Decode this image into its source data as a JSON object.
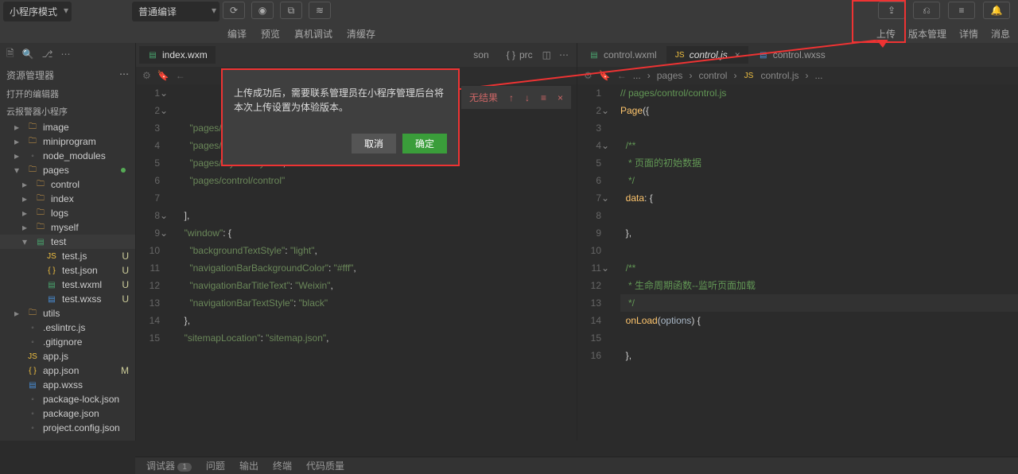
{
  "topbar": {
    "mode": "小程序模式",
    "compile": "普通编译",
    "actions": [
      "编译",
      "预览",
      "真机调试",
      "清缓存"
    ],
    "right": [
      "上传",
      "版本管理",
      "详情",
      "消息"
    ]
  },
  "sidebar": {
    "title": "资源管理器",
    "open_editors": "打开的编辑器",
    "project": "云报警器小程序",
    "tree": [
      {
        "n": "image",
        "t": "folder",
        "d": 0,
        "c": "▸"
      },
      {
        "n": "miniprogram",
        "t": "folder",
        "d": 0,
        "c": "▸"
      },
      {
        "n": "node_modules",
        "t": "folder",
        "d": 0,
        "c": "▸",
        "ico": "grey"
      },
      {
        "n": "pages",
        "t": "folder",
        "d": 0,
        "c": "▾",
        "dot": true
      },
      {
        "n": "control",
        "t": "folder",
        "d": 1,
        "c": "▸"
      },
      {
        "n": "index",
        "t": "folder",
        "d": 1,
        "c": "▸"
      },
      {
        "n": "logs",
        "t": "folder",
        "d": 1,
        "c": "▸"
      },
      {
        "n": "myself",
        "t": "folder",
        "d": 1,
        "c": "▸"
      },
      {
        "n": "test",
        "t": "folder",
        "d": 1,
        "c": "▾",
        "ico": "wxml",
        "act": true
      },
      {
        "n": "test.js",
        "t": "js",
        "d": 2,
        "g": "U"
      },
      {
        "n": "test.json",
        "t": "json",
        "d": 2,
        "g": "U"
      },
      {
        "n": "test.wxml",
        "t": "wxml",
        "d": 2,
        "g": "U"
      },
      {
        "n": "test.wxss",
        "t": "wxss",
        "d": 2,
        "g": "U"
      },
      {
        "n": "utils",
        "t": "folder",
        "d": 0,
        "c": "▸"
      },
      {
        "n": ".eslintrc.js",
        "t": "js",
        "d": 0,
        "ico": "grey"
      },
      {
        "n": ".gitignore",
        "t": "grey",
        "d": 0
      },
      {
        "n": "app.js",
        "t": "js",
        "d": 0
      },
      {
        "n": "app.json",
        "t": "json",
        "d": 0,
        "g": "M"
      },
      {
        "n": "app.wxss",
        "t": "wxss",
        "d": 0
      },
      {
        "n": "package-lock.json",
        "t": "json",
        "d": 0,
        "ico": "grey"
      },
      {
        "n": "package.json",
        "t": "json",
        "d": 0,
        "ico": "grey"
      },
      {
        "n": "project.config.json",
        "t": "json",
        "d": 0,
        "ico": "grey"
      }
    ]
  },
  "left_editor": {
    "tabs": [
      {
        "n": "index.wxm",
        "t": "wxml"
      },
      {
        "n": "son",
        "t": "json"
      },
      {
        "n": "prc",
        "t": "json",
        "pre": "{ }"
      }
    ],
    "lines": [
      "1",
      "2",
      "3",
      "4",
      "5",
      "6",
      "7",
      "8",
      "9",
      "10",
      "11",
      "12",
      "13",
      "14",
      "15"
    ],
    "code": [
      "",
      "",
      "    \"pages/test/test\",",
      "    \"pages/index/index\",",
      "    \"pages/myself/myself\",",
      "    \"pages/control/control\"",
      "",
      "  ],",
      "  \"window\": {",
      "    \"backgroundTextStyle\": \"light\",",
      "    \"navigationBarBackgroundColor\": \"#fff\",",
      "    \"navigationBarTitleText\": \"Weixin\",",
      "    \"navigationBarTextStyle\": \"black\"",
      "  },",
      "  \"sitemapLocation\": \"sitemap.json\","
    ]
  },
  "right_editor": {
    "tabs": [
      {
        "n": "control.wxml",
        "t": "wxml"
      },
      {
        "n": "control.js",
        "t": "js",
        "active": true
      },
      {
        "n": "control.wxss",
        "t": "wxss"
      }
    ],
    "crumbs": [
      "...",
      "pages",
      "control",
      "control.js",
      "..."
    ],
    "lines": [
      "1",
      "2",
      "3",
      "4",
      "5",
      "6",
      "7",
      "8",
      "9",
      "10",
      "11",
      "12",
      "13",
      "14",
      "15",
      "16"
    ],
    "code_raw": "// pages/control/control.js\nPage({\n\n  /**\n   * 页面的初始数据\n   */\n  data: {\n\n  },\n\n  /**\n   * 生命周期函数--监听页面加载\n   */\n  onLoad(options) {\n\n  },"
  },
  "dialog": {
    "text": "上传成功后，需要联系管理员在小程序管理后台将本次上传设置为体验版本。",
    "cancel": "取消",
    "ok": "确定"
  },
  "search": {
    "noresult": "无结果"
  },
  "bottom": {
    "items": [
      "调试器",
      "问题",
      "输出",
      "终端",
      "代码质量"
    ],
    "badge": "1"
  }
}
